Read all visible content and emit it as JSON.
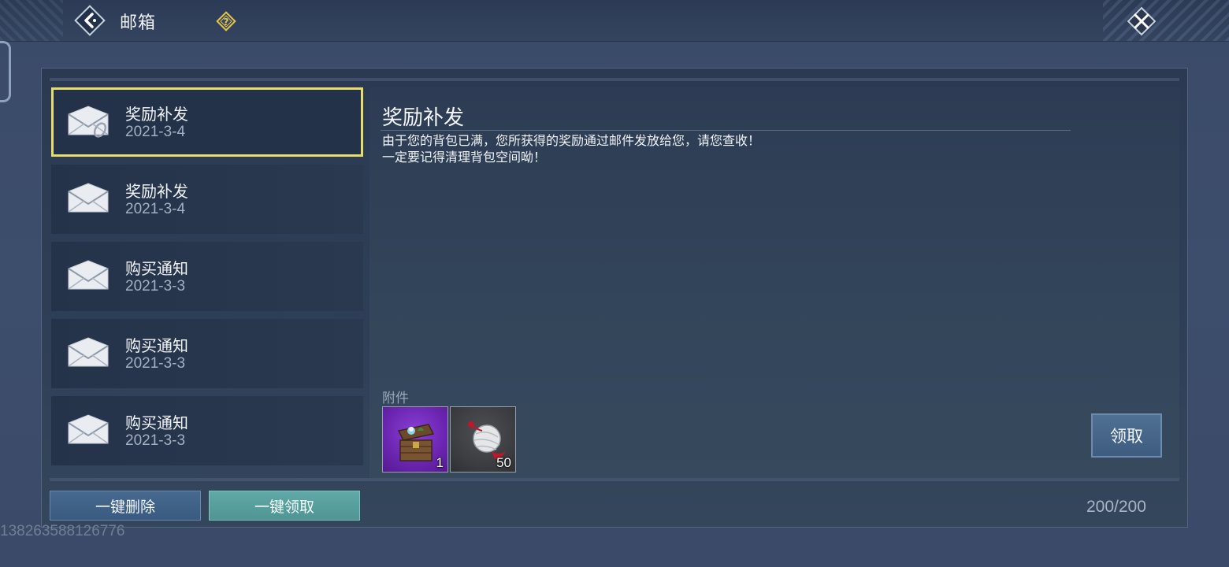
{
  "header": {
    "title": "邮箱",
    "back_icon": "back-arrow-icon",
    "help_icon": "help-icon",
    "close_icon": "close-icon"
  },
  "mail_list": [
    {
      "title": "奖励补发",
      "date": "2021-3-4",
      "icon": "envelope-with-attachment-icon",
      "selected": true
    },
    {
      "title": "奖励补发",
      "date": "2021-3-4",
      "icon": "envelope-icon",
      "selected": false
    },
    {
      "title": "购买通知",
      "date": "2021-3-3",
      "icon": "envelope-icon",
      "selected": false
    },
    {
      "title": "购买通知",
      "date": "2021-3-3",
      "icon": "envelope-icon",
      "selected": false
    },
    {
      "title": "购买通知",
      "date": "2021-3-3",
      "icon": "envelope-icon",
      "selected": false
    }
  ],
  "detail": {
    "title": "奖励补发",
    "body_line1": "由于您的背包已满，您所获得的奖励通过邮件发放给您，请您查收！",
    "body_line2": "一定要记得清理背包空间呦！",
    "attachments_label": "附件",
    "attachments": [
      {
        "icon": "treasure-chest-icon",
        "qty": "1",
        "rarity_color": "#7b34c9"
      },
      {
        "icon": "silk-ball-icon",
        "qty": "50",
        "rarity_color": "#444549"
      }
    ],
    "claim_label": "领取"
  },
  "footer": {
    "delete_all_label": "一键删除",
    "claim_all_label": "一键领取",
    "count": "200/200"
  },
  "watermark": "13826358812677​6"
}
